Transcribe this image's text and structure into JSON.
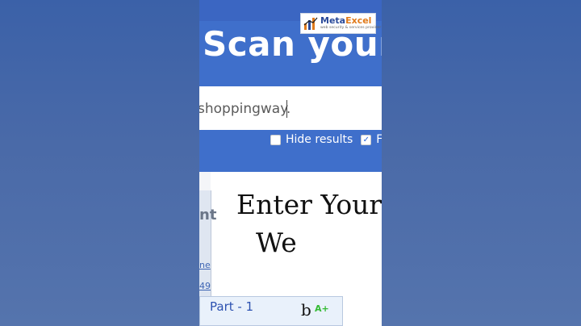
{
  "header": {
    "headline": "Scan your :"
  },
  "search": {
    "value": "shoppingway."
  },
  "options": [
    {
      "label": "Hide results",
      "checked": false
    },
    {
      "label": "F",
      "checked": true
    }
  ],
  "logo": {
    "name_part1": "Meta",
    "name_part2": "Excel",
    "tagline": "web security & services provider"
  },
  "overlay": {
    "line1": "Enter Your",
    "line2": "We"
  },
  "side": {
    "letters": "nt",
    "links": [
      "ne",
      "49",
      "cp"
    ]
  },
  "table": {
    "part_label": "Part - 1",
    "letter": "b",
    "grade": "A+"
  },
  "colors": {
    "hero_blue": "#3f6fcb",
    "logo_orange": "#e07a1a",
    "grade_green": "#33bb33"
  }
}
